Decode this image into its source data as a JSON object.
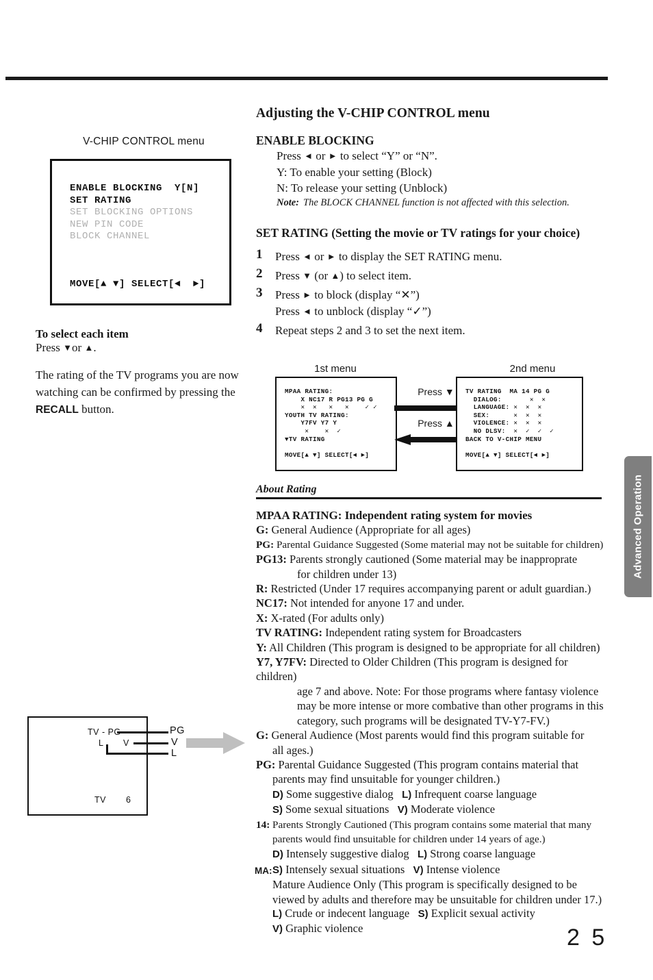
{
  "page": {
    "number": "2 5",
    "side_tab": "Advanced Operation"
  },
  "left_column": {
    "menu_caption": "V-CHIP CONTROL menu",
    "vchip_menu": {
      "items": [
        {
          "text": "ENABLE BLOCKING  Y[N]",
          "dim": false
        },
        {
          "text": "SET RATING",
          "dim": false
        },
        {
          "text": "SET BLOCKING OPTIONS",
          "dim": true
        },
        {
          "text": "NEW PIN CODE",
          "dim": true
        },
        {
          "text": "BLOCK CHANNEL",
          "dim": true
        }
      ],
      "footer": "MOVE[▲ ▼] SELECT[◄  ►]"
    },
    "select_heading": "To select each item",
    "select_sub_pre": "Press ",
    "select_sub_post": "or ",
    "recall_text_1": "The rating of the TV programs you are now watching can be confirmed by pressing the ",
    "recall_bold": "RECALL",
    "recall_text_2": " button."
  },
  "tv_diagram": {
    "inside_label": "TV - PG",
    "inside_l": "L",
    "inside_v": "V",
    "outside_pg": "PG",
    "outside_v": "V",
    "outside_l": "L",
    "bottom_tv": "TV",
    "bottom_ch": "6"
  },
  "right_column": {
    "title": "Adjusting the V-CHIP CONTROL menu",
    "enable_blocking": {
      "heading": "ENABLE BLOCKING",
      "line1_a": "Press ",
      "line1_b": " or ",
      "line1_c": "  to select “Y” or “N”.",
      "line2": "Y: To enable your setting (Block)",
      "line3": "N: To release your setting (Unblock)",
      "note_label": "Note:",
      "note_text": "The BLOCK CHANNEL function is not affected with this selection."
    },
    "set_rating": {
      "heading": "SET RATING (Setting the movie or TV ratings for your choice)",
      "steps": [
        {
          "num": "1",
          "pre": "Press  ",
          "mid": " or ",
          "post": "  to display the SET RATING menu.",
          "type": "lr"
        },
        {
          "num": "2",
          "pre": "Press ",
          "mid": "  (or ",
          "post": ") to select item.",
          "type": "du"
        },
        {
          "num": "3",
          "pre": "Press ",
          "post": " to block (display “✕”)",
          "pre2": "Press ",
          "post2": " to unblock (display “✓”)",
          "type": "block"
        },
        {
          "num": "4",
          "text": "Repeat steps 2 and 3 to set the next item.",
          "type": "plain"
        }
      ]
    }
  },
  "menus": {
    "first": {
      "caption": "1st  menu",
      "lines": [
        "MPAA RATING:",
        "    X NC17 R PG13 PG G",
        "    ✕  ✕   ✕   ✕    ✓ ✓",
        "YOUTH TV RATING:",
        "    Y7FV Y7 Y",
        "     ✕    ✕  ✓",
        "▼TV RATING",
        "",
        "MOVE[▲ ▼] SELECT[◄ ►]"
      ]
    },
    "second": {
      "caption": "2nd menu",
      "lines": [
        "TV RATING  MA 14 PG G",
        "  DIALOG:       ✕  ✕",
        "  LANGUAGE: ✕  ✕  ✕",
        "  SEX:      ✕  ✕  ✕",
        "  VIOLENCE: ✕  ✕  ✕",
        "  NO DLSV:  ✕  ✓  ✓  ✓",
        "BACK TO V-CHIP MENU",
        "",
        "MOVE[▲ ▼] SELECT[◄ ►]"
      ]
    },
    "press_down": "Press ▼",
    "press_up": "Press ▲"
  },
  "about_rating": {
    "heading": "About Rating",
    "mpaa_heading": "MPAA RATING: Independent rating system for movies",
    "entries": [
      {
        "tag": "G:",
        "text": " General Audience (Appropriate for all ages)"
      },
      {
        "tag": "PG:",
        "text": " Parental Guidance Suggested (Some material may not be suitable for children)",
        "small": true
      },
      {
        "tag": "PG13:",
        "text": " Parents strongly cautioned (Some material may be inapproprate"
      },
      {
        "cont": "for  children under 13)",
        "indent": 2
      },
      {
        "tag": "R:",
        "text": " Restricted (Under 17 requires accompanying parent or adult guardian.)"
      },
      {
        "tag": "NC17:",
        "text": " Not intended for anyone 17 and under."
      },
      {
        "tag": "X:",
        "text": " X-rated (For adults only)"
      },
      {
        "tag": "TV RATING:",
        "text": " Independent rating system for Broadcasters"
      },
      {
        "tag": "Y:",
        "text": " All Children (This program is designed to be appropriate for all children)"
      },
      {
        "tag": "Y7, Y7FV:",
        "text": " Directed to Older Children (This program is designed for children)"
      },
      {
        "cont": "age 7 and above. Note: For those programs where fantasy violence",
        "indent": 2
      },
      {
        "cont": "may be more intense or more combative than other programs in this",
        "indent": 2
      },
      {
        "cont": "category, such programs will be designated TV-Y7-FV.)",
        "indent": 2
      },
      {
        "tag": "G:",
        "text": " General Audience (Most parents would find this program suitable for"
      },
      {
        "cont": "all ages.)",
        "indent": 1
      },
      {
        "tag": "PG:",
        "text": " Parental Guidance Suggested (This program contains material that"
      },
      {
        "cont": "parents may find unsuitable for younger children.)",
        "indent": 1
      },
      {
        "sub": [
          {
            "k": "D)",
            "v": " Some suggestive dialog"
          },
          {
            "k": "L)",
            "v": " Infrequent coarse language"
          }
        ],
        "indent": 1
      },
      {
        "sub": [
          {
            "k": "S)",
            "v": " Some sexual situations"
          },
          {
            "k": "V)",
            "v": " Moderate violence"
          }
        ],
        "indent": 1
      },
      {
        "tag": "14:",
        "text": " Parents Strongly Cautioned (This program contains some material that many",
        "small": true
      },
      {
        "cont": "parents would find unsuitable for children under 14 years of age.)",
        "indent": 1,
        "small": true
      },
      {
        "sub": [
          {
            "k": "D)",
            "v": " Intensely suggestive dialog"
          },
          {
            "k": "L)",
            "v": " Strong coarse language"
          }
        ],
        "indent": 1
      },
      {
        "sub": [
          {
            "k": "S)",
            "v": " Intensely sexual situations"
          },
          {
            "k": "V)",
            "v": " Intense violence"
          }
        ],
        "indent": 1,
        "ma": "MA:"
      },
      {
        "cont": "Mature Audience Only (This program is specifically designed to be",
        "indent": 1
      },
      {
        "cont": "viewed by adults and therefore may be unsuitable for children under 17.)",
        "indent": 1
      },
      {
        "sub": [
          {
            "k": "L)",
            "v": " Crude or indecent language"
          },
          {
            "k": "S)",
            "v": " Explicit sexual activity"
          }
        ],
        "indent": 1,
        "tight": true
      },
      {
        "sub": [
          {
            "k": "V)",
            "v": " Graphic violence"
          }
        ],
        "indent": 1
      }
    ]
  },
  "colors": {
    "ink": "#1a1a1a",
    "dim_menu_text": "#b0b0b0",
    "side_tab_bg": "#7f7f7f",
    "gray_arrow": "#bfbfbf"
  }
}
